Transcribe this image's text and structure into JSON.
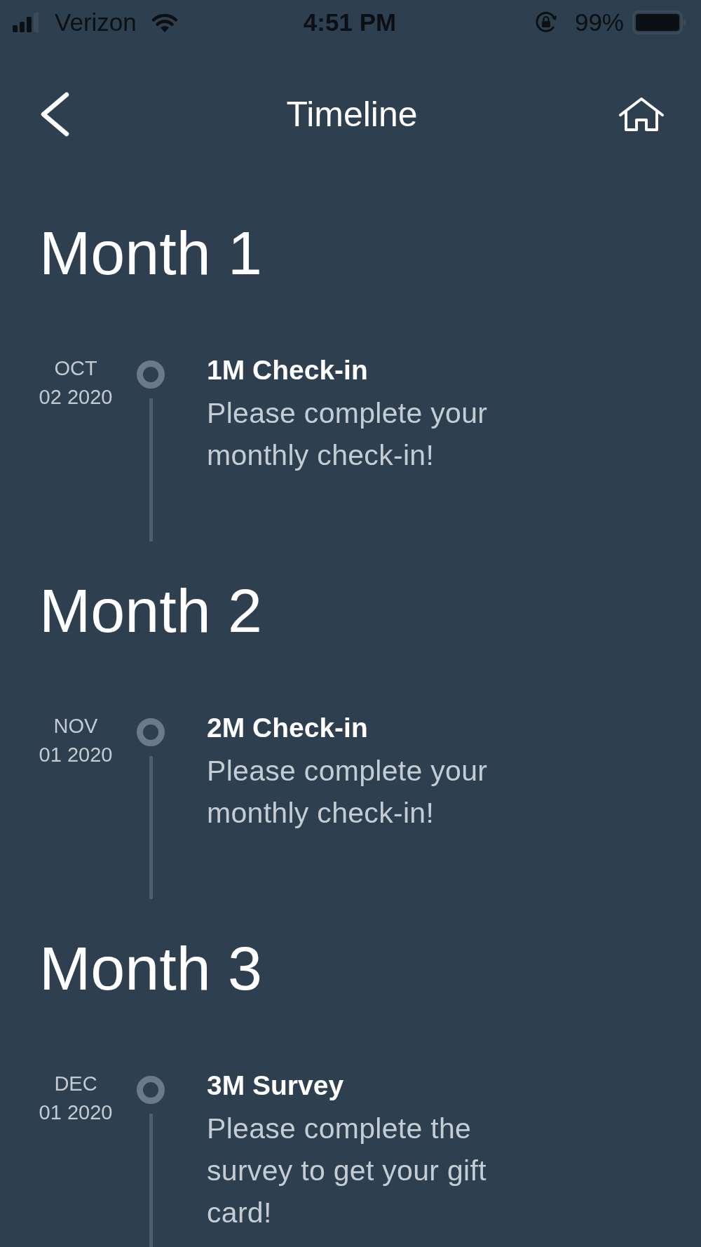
{
  "status_bar": {
    "carrier": "Verizon",
    "time": "4:51 PM",
    "battery": "99%"
  },
  "header": {
    "title": "Timeline"
  },
  "months": [
    {
      "title": "Month 1",
      "events": [
        {
          "month": "OCT",
          "date": "02 2020",
          "title": "1M Check-in",
          "description": "Please complete your monthly check-in!"
        }
      ]
    },
    {
      "title": "Month 2",
      "events": [
        {
          "month": "NOV",
          "date": "01 2020",
          "title": "2M Check-in",
          "description": "Please complete your monthly check-in!"
        }
      ]
    },
    {
      "title": "Month 3",
      "events": [
        {
          "month": "DEC",
          "date": "01 2020",
          "title": "3M Survey",
          "description": "Please complete the survey to get your gift card!"
        }
      ]
    }
  ]
}
